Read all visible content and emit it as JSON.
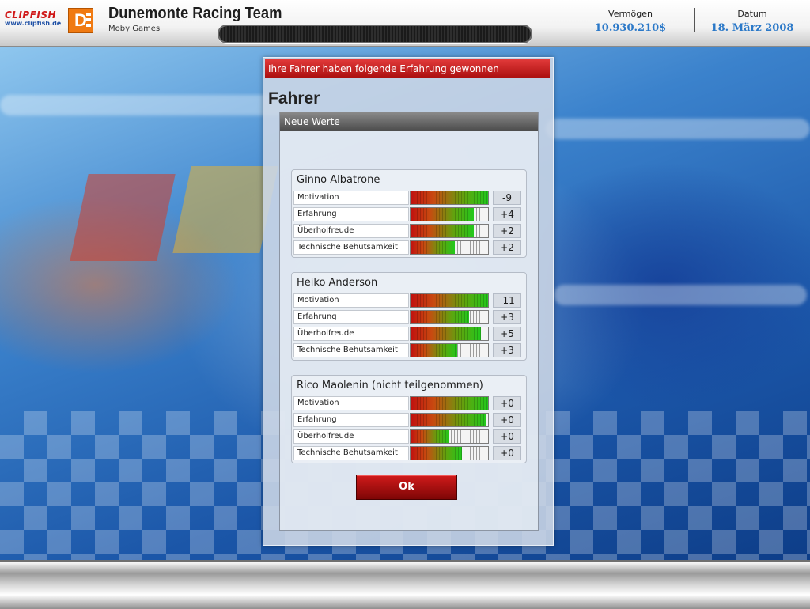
{
  "header": {
    "brand_wordmark": "CLIPFISH",
    "brand_url": "www.clipfish.de",
    "team_logo_letter": "D",
    "team_title": "Dunemonte Racing Team",
    "team_subtitle": "Moby Games",
    "vermoegen_label": "Vermögen",
    "vermoegen_value": "10.930.210$",
    "datum_label": "Datum",
    "datum_value": "18. März 2008"
  },
  "dialog": {
    "title": "Ihre Fahrer haben folgende Erfahrung gewonnen",
    "section_heading": "Fahrer",
    "panel_header": "Neue Werte",
    "ok_label": "Ok",
    "drivers": [
      {
        "name": "Ginno Albatrone",
        "stats": [
          {
            "label": "Motivation",
            "delta": "-9",
            "level": 1.0
          },
          {
            "label": "Erfahrung",
            "delta": "+4",
            "level": 0.82
          },
          {
            "label": "Überholfreude",
            "delta": "+2",
            "level": 0.82
          },
          {
            "label": "Technische Behutsamkeit",
            "delta": "+2",
            "level": 0.57
          }
        ]
      },
      {
        "name": "Heiko Anderson",
        "stats": [
          {
            "label": "Motivation",
            "delta": "-11",
            "level": 1.0
          },
          {
            "label": "Erfahrung",
            "delta": "+3",
            "level": 0.76
          },
          {
            "label": "Überholfreude",
            "delta": "+5",
            "level": 0.91
          },
          {
            "label": "Technische Behutsamkeit",
            "delta": "+3",
            "level": 0.6
          }
        ]
      },
      {
        "name": "Rico Maolenin (nicht teilgenommen)",
        "stats": [
          {
            "label": "Motivation",
            "delta": "+0",
            "level": 1.0
          },
          {
            "label": "Erfahrung",
            "delta": "+0",
            "level": 0.97
          },
          {
            "label": "Überholfreude",
            "delta": "+0",
            "level": 0.5
          },
          {
            "label": "Technische Behutsamkeit",
            "delta": "+0",
            "level": 0.66
          }
        ]
      }
    ]
  },
  "colors": {
    "title_red": "#c01616",
    "value_blue": "#2a78c8",
    "bar_low": "#c01010",
    "bar_high": "#22c81c"
  }
}
